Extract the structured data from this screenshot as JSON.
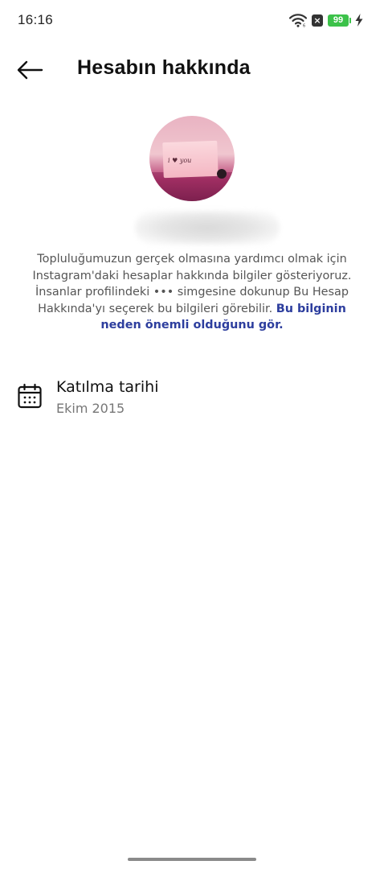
{
  "status_bar": {
    "time": "16:16",
    "battery": "99",
    "icons": [
      "wifi-icon",
      "notification-x-icon",
      "battery-icon",
      "charging-bolt-icon"
    ],
    "battery_color": "#3cc24a"
  },
  "header": {
    "back_icon": "arrow-left-icon",
    "title": "Hesabın hakkında"
  },
  "profile": {
    "avatar": "profile-photo (card with 'i ♥ you')",
    "avatar_text": "i ♥ you",
    "username": ""
  },
  "description": {
    "text": "Topluluğumuzun gerçek olmasına yardımcı olmak için Instagram'daki hesaplar hakkında bilgiler gösteriyoruz. İnsanlar profilindeki ••• simgesine dokunup Bu Hesap Hakkında'yı seçerek bu bilgileri görebilir.",
    "link": "Bu bilginin neden önemli olduğunu gör.",
    "link_color": "#2d3e9e"
  },
  "info": {
    "icon": "calendar-icon",
    "label": "Katılma tarihi",
    "value": "Ekim 2015"
  }
}
